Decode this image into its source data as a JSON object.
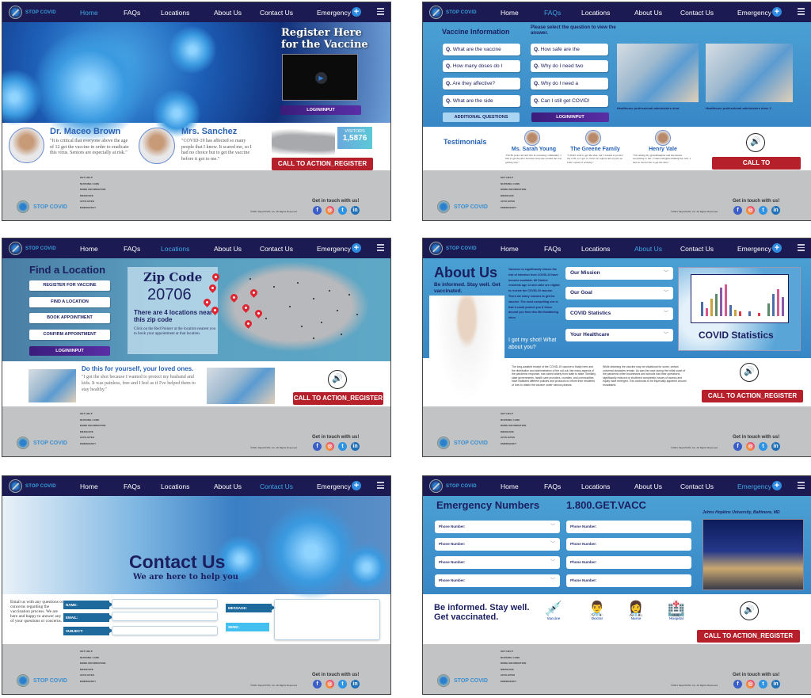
{
  "brand": {
    "name": "STOP COVID"
  },
  "nav": {
    "items": [
      "Home",
      "FAQs",
      "Locations",
      "About Us",
      "Contact Us",
      "Emergency"
    ],
    "emergency_icon": "plus-circle-icon",
    "menu_icon": "hamburger-menu-icon"
  },
  "footer": {
    "links": [
      "GET HELP",
      "NURSING CARE",
      "MORE INFORMATION",
      "MEDICARE",
      "AFFILIATES",
      "EMERGENCY"
    ],
    "copyright": "©2021 StopCOVID, Inc. All Rights Reserved",
    "get_in_touch": "Get in touch with us!",
    "social": [
      {
        "name": "facebook",
        "glyph": "f"
      },
      {
        "name": "instagram",
        "glyph": "◎"
      },
      {
        "name": "twitter",
        "glyph": "t"
      },
      {
        "name": "linkedin",
        "glyph": "in"
      }
    ]
  },
  "common": {
    "cta": "CALL TO ACTION_REGISTER",
    "login": "LOGIN/INPUT",
    "speaker_glyph": "🔊"
  },
  "home": {
    "register_title": "Register Here for the Vaccine",
    "play_glyph": "▶",
    "testimonials": [
      {
        "name": "Dr. Maceo Brown",
        "quote": "\"It is critical that everyone above the age of 12 get the vaccine in order to eradicate this virus. Seniors are especially at risk.\""
      },
      {
        "name": "Mrs. Sanchez",
        "quote": "\"COVID-19 has affected so many people that I know. It scared me, so I had no choice but to get the vaccine before it got to me.\""
      }
    ],
    "visitors_label": "VISITORS",
    "visitors_count": "1,5876"
  },
  "faq": {
    "title": "Vaccine Information",
    "prompt": "Please select the question to view the answer.",
    "questions_left": [
      "What are the vaccine",
      "How many doses do I",
      "Are they affective?",
      "What are the side"
    ],
    "questions_right": [
      "How safe are the",
      "Why do I need two",
      "Why do I need a",
      "Can I still get COVID!"
    ],
    "q_prefix": "Q.",
    "additional": "ADDITIONAL QUESTIONS",
    "captions": [
      "Healthcare professional administers shot",
      "Healthcare professional administers dose 2"
    ],
    "testimonials_title": "Testimonials",
    "testimonials": [
      {
        "name": "Ms. Sarah Young",
        "quote": "\"I'm 82 years old and live in a nursing community. I had to get the shot because everyone around me was getting sick.\""
      },
      {
        "name": "The Greene Family",
        "quote": "\"I didn't want to get the shot, but I wanted to protect my wife, so I got it. I have no regrets and it gave us both a sense of security.\""
      },
      {
        "name": "Henry Vale",
        "quote": "\"I'm raising my granddaughter and she means everything to me. I cannot imagine making her sick. I had no choice but to get the shot.\""
      }
    ]
  },
  "locations": {
    "title": "Find a Location",
    "buttons": [
      "REGISTER FOR VACCINE",
      "FIND A LOCATION",
      "BOOK APPOINTMENT",
      "CONFIRM APPOINTMENT"
    ],
    "zip_title": "Zip Code",
    "zip_value": "20706",
    "nearby": "There are 4 locations near this zip code",
    "instructions": "Click on the Red Pointer at the location nearest you to book your appointment at that location.",
    "story_title": "Do this for yourself, your loved ones.",
    "story_quote": "\"I got the shot because I wanted to protect my husband and kids. It was painless, free and I feel as if I've helped them to stay healthy.\""
  },
  "about": {
    "title": "About Us",
    "subtitle": "Be informed. Stay well. Get vaccinated.",
    "intro": "Vaccines to significantly reduce the risk of infection from COVID-19 have become available. All District residents age 12 and older are eligible to receive the COVID-19 vaccine. There are many reasons to get the vaccine. The most compelling one is that it could protect you & those around you from this life-threatening virus.",
    "got_shot": "I got my shot! What about you?",
    "accordion": [
      "Our Mission",
      "Our Goal",
      "COVID Statistics",
      "Your Healthcare"
    ],
    "stats_title": "COVID Statistics",
    "para1": "The long-awaited receipt of the COVID-19 vaccine is finally here and the distribution and administration of the roll-out, like many aspects of the pandemic response, has varied widely from state to state. Similarly, state governments, health care providers, counties, and communities, have instituted different policies and protocols to inform their residents of how to obtain the vaccine under various phases.",
    "para2": "While obtaining the vaccine may be situational for some, certain universal obstacles remain. As was the case during the initial onset of the pandemic when businesses and schools had their operations significantly reduced or shuttered completely, issues of access and equity have emerged. This continues to be especially apparent around broadband."
  },
  "contact": {
    "title": "Contact Us",
    "subtitle": "We are here to help you",
    "intro": "Email us with any questions or concerns regarding the vaccination process. We are here and happy to answer any of your questions or concerns.",
    "fields": [
      "NAME:",
      "EMAIL:",
      "SUBJECT:"
    ],
    "message_label": "MESSAGE:",
    "send_label": "SEND:"
  },
  "emergency": {
    "title": "Emergency Numbers",
    "hotline": "1.800.GET.VACC",
    "phone_label": "Phone Number:",
    "location_caption": "Johns Hopkins University, Baltimore, MD",
    "tagline": "Be informed. Stay well. Get vaccinated.",
    "icons": [
      {
        "label": "Vaccine",
        "glyph": "💉"
      },
      {
        "label": "Doctor",
        "glyph": "👨‍⚕️"
      },
      {
        "label": "Nurse",
        "glyph": "👩‍⚕️"
      },
      {
        "label": "Hospital",
        "glyph": "🏥"
      }
    ]
  },
  "colors": {
    "nav": "#1b1a52",
    "active": "#3fa9e8",
    "cta": "#b5202a",
    "heading": "#1b1f60",
    "accent_blue": "#2863b6",
    "footer": "#c2c3c5"
  }
}
